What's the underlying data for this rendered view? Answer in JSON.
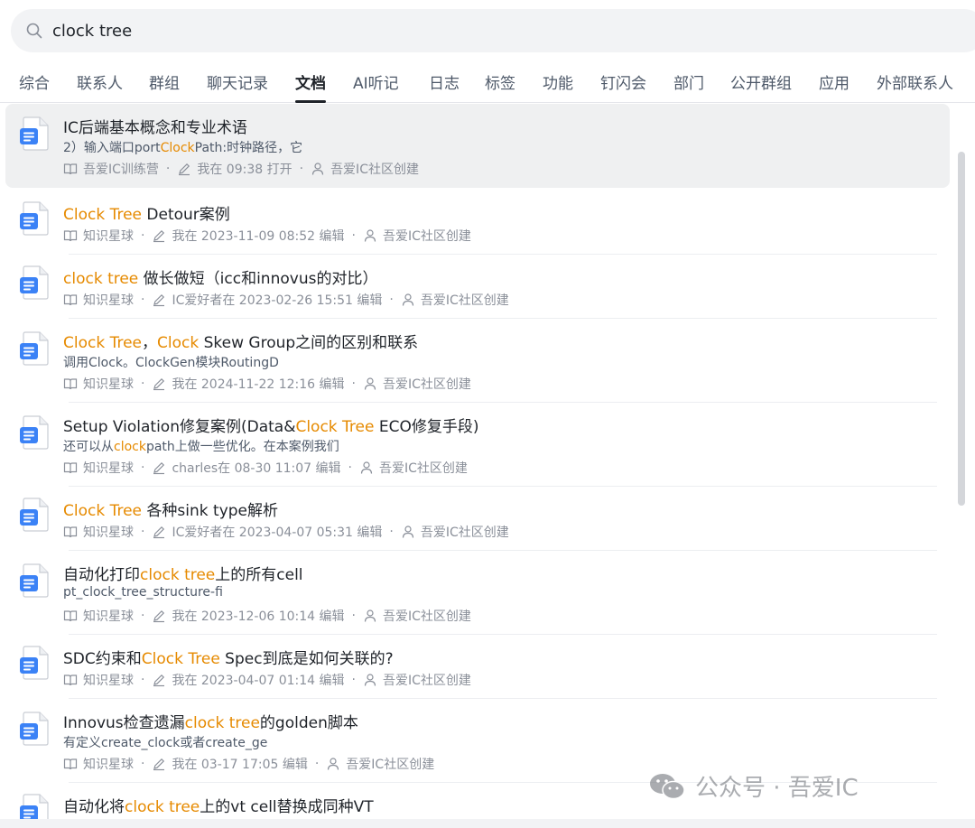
{
  "search": {
    "query": "clock tree"
  },
  "tabs": [
    {
      "label": "综合"
    },
    {
      "label": "联系人"
    },
    {
      "label": "群组"
    },
    {
      "label": "聊天记录"
    },
    {
      "label": "文档",
      "active": true
    },
    {
      "label": "AI听记"
    },
    {
      "label": "日志"
    },
    {
      "label": "标签"
    },
    {
      "label": "功能"
    },
    {
      "label": "钉闪会"
    },
    {
      "label": "部门"
    },
    {
      "label": "公开群组"
    },
    {
      "label": "应用"
    },
    {
      "label": "外部联系人"
    }
  ],
  "colors": {
    "highlight": "#e68a00",
    "doc_icon": "#3b82f6",
    "selected_bg": "#eff0f1"
  },
  "results": [
    {
      "title": [
        {
          "t": "IC后端基本概念和专业术语"
        }
      ],
      "snippet": [
        {
          "t": "2）输入端口port"
        },
        {
          "t": "Clock",
          "hl": true
        },
        {
          "t": "Path:时钟路径，它"
        }
      ],
      "space": "吾爱IC训练营",
      "edit": "我在 09:38 打开",
      "creator": "吾爱IC社区创建"
    },
    {
      "title": [
        {
          "t": "Clock Tree",
          "hl": true
        },
        {
          "t": " Detour案例"
        }
      ],
      "space": "知识星球",
      "edit": "我在 2023-11-09 08:52 编辑",
      "creator": "吾爱IC社区创建"
    },
    {
      "title": [
        {
          "t": "clock tree",
          "hl": true
        },
        {
          "t": " 做长做短（icc和innovus的对比）"
        }
      ],
      "space": "知识星球",
      "edit": "IC爱好者在 2023-02-26 15:51 编辑",
      "creator": "吾爱IC社区创建"
    },
    {
      "title": [
        {
          "t": "Clock Tree",
          "hl": true
        },
        {
          "t": "，"
        },
        {
          "t": "Clock",
          "hl": true
        },
        {
          "t": " Skew Group之间的区别和联系"
        }
      ],
      "snippet": [
        {
          "t": "调用Clock。ClockGen模块RoutingD"
        }
      ],
      "space": "知识星球",
      "edit": "我在 2024-11-22 12:16 编辑",
      "creator": "吾爱IC社区创建"
    },
    {
      "title": [
        {
          "t": "Setup Violation修复案例(Data&"
        },
        {
          "t": "Clock Tree",
          "hl": true
        },
        {
          "t": " ECO修复手段)"
        }
      ],
      "snippet": [
        {
          "t": "还可以从"
        },
        {
          "t": "clock",
          "hl": true
        },
        {
          "t": "path上做一些优化。在本案例我们"
        }
      ],
      "space": "知识星球",
      "edit": "charles在 08-30 11:07 编辑",
      "creator": "吾爱IC社区创建"
    },
    {
      "title": [
        {
          "t": "Clock Tree",
          "hl": true
        },
        {
          "t": " 各种sink type解析"
        }
      ],
      "space": "知识星球",
      "edit": "IC爱好者在 2023-04-07 05:31 编辑",
      "creator": "吾爱IC社区创建"
    },
    {
      "title": [
        {
          "t": "自动化打印"
        },
        {
          "t": "clock tree",
          "hl": true
        },
        {
          "t": "上的所有cell"
        }
      ],
      "snippet": [
        {
          "t": "pt_clock_tree_structure-fi"
        }
      ],
      "space": "知识星球",
      "edit": "我在 2023-12-06 10:14 编辑",
      "creator": "吾爱IC社区创建"
    },
    {
      "title": [
        {
          "t": "SDC约束和"
        },
        {
          "t": "Clock Tree",
          "hl": true
        },
        {
          "t": " Spec到底是如何关联的?"
        }
      ],
      "space": "知识星球",
      "edit": "我在 2023-04-07 01:14 编辑",
      "creator": "吾爱IC社区创建"
    },
    {
      "title": [
        {
          "t": "Innovus检查遗漏"
        },
        {
          "t": "clock tree",
          "hl": true
        },
        {
          "t": "的golden脚本"
        }
      ],
      "snippet": [
        {
          "t": "有定义create_clock或者create_ge"
        }
      ],
      "space": "知识星球",
      "edit": "我在 03-17 17:05 编辑",
      "creator": "吾爱IC社区创建"
    },
    {
      "title": [
        {
          "t": "自动化将"
        },
        {
          "t": "clock tree",
          "hl": true
        },
        {
          "t": "上的vt cell替换成同种VT"
        }
      ]
    }
  ],
  "watermark": {
    "text": "公众号 · 吾爱IC",
    "icon": "wechat-icon"
  }
}
